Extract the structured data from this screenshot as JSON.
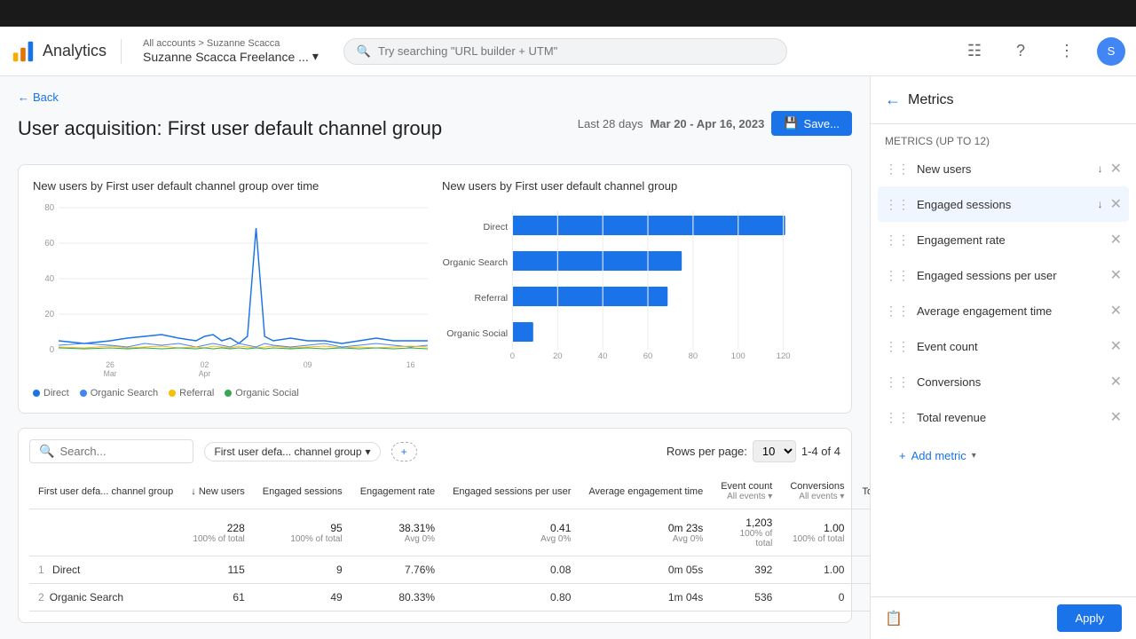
{
  "app": {
    "name": "Analytics"
  },
  "header": {
    "logo_alt": "Google Analytics logo",
    "breadcrumb": "All accounts > Suzanne Scacca",
    "account_name": "Suzanne Scacca Freelance ...",
    "search_placeholder": "Try searching \"URL builder + UTM\"",
    "back_label": "Back"
  },
  "page": {
    "title": "User acquisition: First user default channel group",
    "date_range_label": "Last 28 days",
    "date_range": "Mar 20 - Apr 16, 2023",
    "save_label": "Save..."
  },
  "charts": {
    "left_title": "New users by First user default channel group over time",
    "right_title": "New users by First user default channel group",
    "legend": [
      "Direct",
      "Organic Search",
      "Referral",
      "Organic Social"
    ],
    "legend_colors": [
      "#1a73e8",
      "#4285f4",
      "#fbbc04",
      "#34a853"
    ],
    "x_labels_left": [
      "26 Mar",
      "02 Apr",
      "09",
      "16"
    ],
    "y_labels_left": [
      "80",
      "60",
      "40",
      "20",
      "0"
    ],
    "bar_data": [
      {
        "label": "Direct",
        "value": 120,
        "max": 120
      },
      {
        "label": "Organic Search",
        "value": 72,
        "max": 120
      },
      {
        "label": "Referral",
        "value": 65,
        "max": 120
      },
      {
        "label": "Organic Social",
        "value": 8,
        "max": 120
      }
    ],
    "x_labels_right": [
      "0",
      "20",
      "40",
      "60",
      "80",
      "100",
      "120"
    ]
  },
  "table": {
    "search_placeholder": "Search...",
    "rows_per_page_label": "Rows per page:",
    "rows_per_page": "10",
    "rows_count": "1-4 of 4",
    "dimension_filter": "First user defa... channel group",
    "columns": [
      {
        "id": "channel",
        "label": "First user defa... channel group",
        "sortable": false
      },
      {
        "id": "new_users",
        "label": "New users",
        "sub": "",
        "sortable": true,
        "sorted": true
      },
      {
        "id": "engaged_sessions",
        "label": "Engaged sessions",
        "sub": ""
      },
      {
        "id": "engagement_rate",
        "label": "Engagement rate",
        "sub": ""
      },
      {
        "id": "engaged_sessions_per_user",
        "label": "Engaged sessions per user",
        "sub": ""
      },
      {
        "id": "avg_engagement_time",
        "label": "Average engagement time",
        "sub": ""
      },
      {
        "id": "event_count",
        "label": "Event count",
        "sub": "All events"
      },
      {
        "id": "conversions",
        "label": "Conversions",
        "sub": "All events"
      },
      {
        "id": "total_revenue",
        "label": "Total r...",
        "sub": ""
      }
    ],
    "total_row": {
      "channel": "",
      "new_users": "228",
      "new_users_note": "100% of total",
      "engaged_sessions": "95",
      "engaged_sessions_note": "100% of total",
      "engagement_rate": "38.31%",
      "engagement_rate_note": "Avg 0%",
      "engaged_sessions_per_user": "0.41",
      "engaged_sessions_per_user_note": "Avg 0%",
      "avg_engagement_time": "0m 23s",
      "avg_engagement_time_note": "Avg 0%",
      "event_count": "1,203",
      "event_count_note": "100% of total",
      "conversions": "1.00",
      "conversions_note": "100% of total",
      "total_revenue": "$"
    },
    "rows": [
      {
        "num": "1",
        "channel": "Direct",
        "new_users": "115",
        "engaged_sessions": "9",
        "engagement_rate": "7.76%",
        "engaged_sessions_per_user": "0.08",
        "avg_engagement_time": "0m 05s",
        "event_count": "392",
        "conversions": "1.00",
        "total_revenue": ""
      }
    ]
  },
  "metrics_panel": {
    "title": "Metrics",
    "label": "METRICS (UP TO 12)",
    "metrics": [
      {
        "name": "New users",
        "has_sort": true
      },
      {
        "name": "Engaged sessions",
        "has_sort": true
      },
      {
        "name": "Engagement rate",
        "has_sort": false
      },
      {
        "name": "Engaged sessions per user",
        "has_sort": false
      },
      {
        "name": "Average engagement time",
        "has_sort": false
      },
      {
        "name": "Event count",
        "has_sort": false
      },
      {
        "name": "Conversions",
        "has_sort": false
      },
      {
        "name": "Total revenue",
        "has_sort": false
      }
    ],
    "add_metric_label": "Add metric",
    "apply_label": "Apply"
  }
}
